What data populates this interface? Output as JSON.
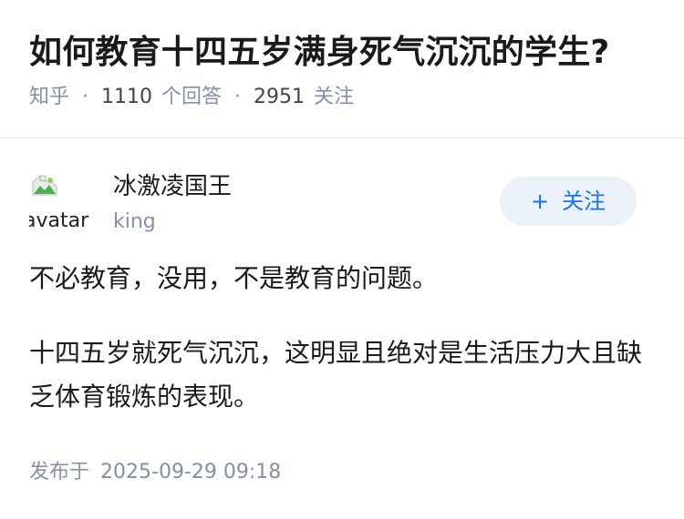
{
  "question": {
    "title": "如何教育十四五岁满身死气沉沉的学生?",
    "source": "知乎",
    "answers_count": "1110",
    "answers_label": "个回答",
    "follow_count": "2951",
    "follow_label": "关注",
    "separator": "·"
  },
  "author": {
    "avatar_alt": "avatar",
    "name": "冰激凌国王",
    "headline": "king",
    "follow_plus": "+",
    "follow_label": "关注"
  },
  "answer": {
    "paragraphs": [
      "不必教育，没用，不是教育的问题。",
      "十四五岁就死气沉沉，这明显且绝对是生活压力大且缺乏体育锻炼的表现。"
    ],
    "published_label": "发布于",
    "published_date": "2025-09-29 09:18"
  },
  "colors": {
    "text": "#1a1a1a",
    "meta": "#8590a6",
    "brand_blue": "#1772f6",
    "follow_bg": "#eaf1f9"
  },
  "icons": {
    "avatar": "broken-image-icon"
  }
}
